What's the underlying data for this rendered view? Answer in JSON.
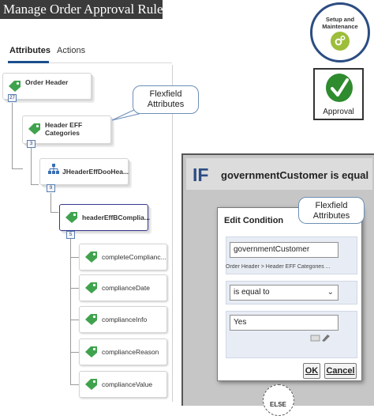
{
  "header": {
    "title": "Manage Order Approval Rules"
  },
  "tabs": [
    {
      "label": "Attributes",
      "active": true
    },
    {
      "label": "Actions",
      "active": false
    }
  ],
  "tree": {
    "root": {
      "label": "Order Header",
      "badge": "27"
    },
    "level1": {
      "label_line1": "Header EFF",
      "label_line2": "Categories",
      "badge": "3"
    },
    "level2": {
      "label": "JHeaderEffDooHea...",
      "badge": "9"
    },
    "level3": {
      "label": "headerEffBComplia...",
      "badge": "5"
    },
    "leaves": [
      {
        "label": "completeComplianc..."
      },
      {
        "label": "complianceDate"
      },
      {
        "label": "complianceInfo"
      },
      {
        "label": "complianceReason"
      },
      {
        "label": "complianceValue"
      }
    ]
  },
  "callouts": {
    "tree_line1": "Flexfield",
    "tree_line2": "Attributes",
    "dialog_line1": "Flexfield",
    "dialog_line2": "Attributes"
  },
  "setup": {
    "line1": "Setup and",
    "line2": "Maintenance",
    "icon": "gear-icon"
  },
  "approval": {
    "label": "Approval",
    "icon": "checkmark-icon"
  },
  "rule": {
    "keyword": "IF",
    "condition_text": "governmentCustomer is equal"
  },
  "dialog": {
    "title": "Edit Condition",
    "attribute_value": "governmentCustomer",
    "attribute_path": "Order Header > Header EFF Categories ...",
    "operator_value": "is equal to",
    "value_value": "Yes",
    "ok_label": "OK",
    "cancel_label": "Cancel"
  },
  "else_label": "ELSE",
  "colors": {
    "brand_blue": "#2c4d83",
    "tag_green": "#3fa34d",
    "approval_green": "#2e8b2e",
    "gear_green": "#9dbe3a"
  }
}
